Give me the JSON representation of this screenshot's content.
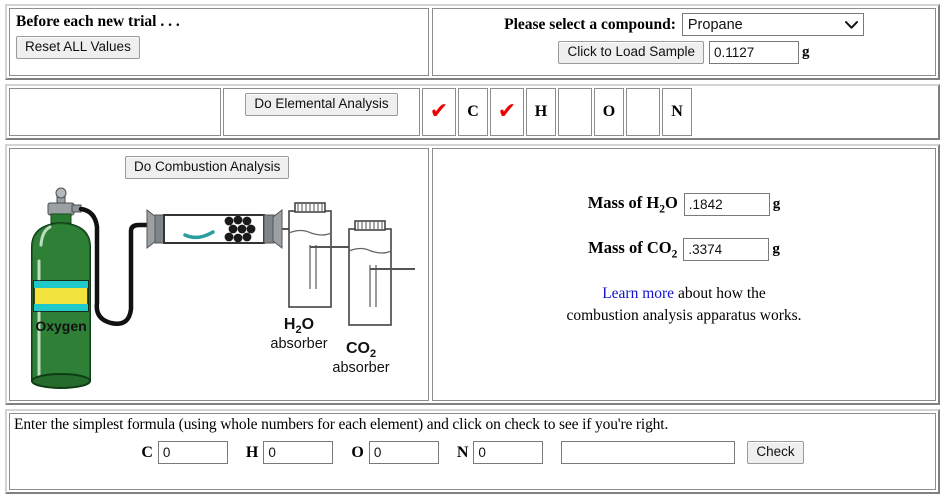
{
  "trial": {
    "heading": "Before each new trial . . .",
    "reset_label": "Reset ALL Values"
  },
  "compound": {
    "heading": "Please select a compound:",
    "selected": "Propane",
    "options": [
      "Propane"
    ],
    "load_label": "Click to Load Sample",
    "mass_value": "0.1127",
    "mass_unit": "g"
  },
  "elemental": {
    "button_label": "Do Elemental Analysis",
    "results": [
      {
        "symbol": "C",
        "detected": true,
        "mark": "✔"
      },
      {
        "symbol": "H",
        "detected": true,
        "mark": "✔"
      },
      {
        "symbol": "O",
        "detected": false,
        "mark": ""
      },
      {
        "symbol": "N",
        "detected": false,
        "mark": ""
      }
    ],
    "check_color": "#ee0000"
  },
  "combustion": {
    "button_label": "Do Combustion Analysis",
    "water": {
      "label_pre": "Mass of H",
      "label_sub": "2",
      "label_post": "O",
      "value": ".1842",
      "unit": "g"
    },
    "carbon_dioxide": {
      "label_pre": "Mass of CO",
      "label_sub": "2",
      "label_post": "",
      "value": ".3374",
      "unit": "g"
    },
    "learn_link": "Learn more",
    "learn_text_1": " about how the",
    "learn_text_2": "combustion analysis apparatus works."
  },
  "apparatus": {
    "tank_label": "Oxygen",
    "water_absorber_line1_pre": "H",
    "water_absorber_line1_sub": "2",
    "water_absorber_line1_post": "O",
    "water_absorber_line2": "absorber",
    "co2_absorber_line1_pre": "CO",
    "co2_absorber_line1_sub": "2",
    "co2_absorber_line2": "absorber",
    "tank_color": "#2b7a33",
    "band_yellow": "#f2e43c",
    "band_cyan": "#1fc9c9"
  },
  "formula": {
    "instruction": "Enter the simplest formula (using whole numbers for each element) and click on check to see if you're right.",
    "elements": [
      {
        "symbol": "C",
        "value": "0"
      },
      {
        "symbol": "H",
        "value": "0"
      },
      {
        "symbol": "O",
        "value": "0"
      },
      {
        "symbol": "N",
        "value": "0"
      }
    ],
    "answer_value": "",
    "check_label": "Check"
  }
}
